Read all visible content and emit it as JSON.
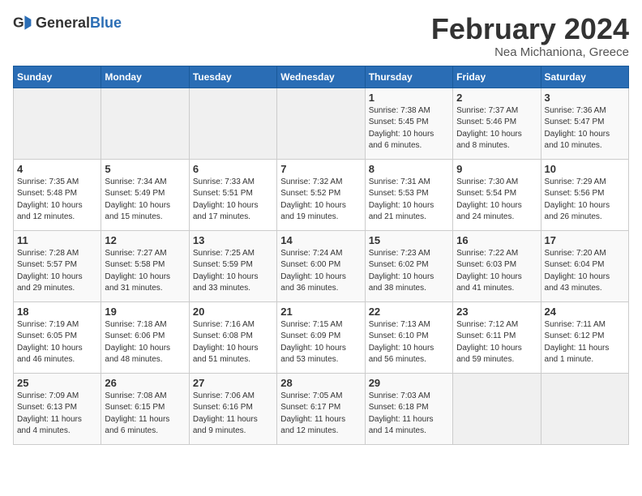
{
  "header": {
    "logo_general": "General",
    "logo_blue": "Blue",
    "month_title": "February 2024",
    "location": "Nea Michaniona, Greece"
  },
  "days_of_week": [
    "Sunday",
    "Monday",
    "Tuesday",
    "Wednesday",
    "Thursday",
    "Friday",
    "Saturday"
  ],
  "weeks": [
    {
      "days": [
        {
          "num": "",
          "info": ""
        },
        {
          "num": "",
          "info": ""
        },
        {
          "num": "",
          "info": ""
        },
        {
          "num": "",
          "info": ""
        },
        {
          "num": "1",
          "info": "Sunrise: 7:38 AM\nSunset: 5:45 PM\nDaylight: 10 hours\nand 6 minutes."
        },
        {
          "num": "2",
          "info": "Sunrise: 7:37 AM\nSunset: 5:46 PM\nDaylight: 10 hours\nand 8 minutes."
        },
        {
          "num": "3",
          "info": "Sunrise: 7:36 AM\nSunset: 5:47 PM\nDaylight: 10 hours\nand 10 minutes."
        }
      ]
    },
    {
      "days": [
        {
          "num": "4",
          "info": "Sunrise: 7:35 AM\nSunset: 5:48 PM\nDaylight: 10 hours\nand 12 minutes."
        },
        {
          "num": "5",
          "info": "Sunrise: 7:34 AM\nSunset: 5:49 PM\nDaylight: 10 hours\nand 15 minutes."
        },
        {
          "num": "6",
          "info": "Sunrise: 7:33 AM\nSunset: 5:51 PM\nDaylight: 10 hours\nand 17 minutes."
        },
        {
          "num": "7",
          "info": "Sunrise: 7:32 AM\nSunset: 5:52 PM\nDaylight: 10 hours\nand 19 minutes."
        },
        {
          "num": "8",
          "info": "Sunrise: 7:31 AM\nSunset: 5:53 PM\nDaylight: 10 hours\nand 21 minutes."
        },
        {
          "num": "9",
          "info": "Sunrise: 7:30 AM\nSunset: 5:54 PM\nDaylight: 10 hours\nand 24 minutes."
        },
        {
          "num": "10",
          "info": "Sunrise: 7:29 AM\nSunset: 5:56 PM\nDaylight: 10 hours\nand 26 minutes."
        }
      ]
    },
    {
      "days": [
        {
          "num": "11",
          "info": "Sunrise: 7:28 AM\nSunset: 5:57 PM\nDaylight: 10 hours\nand 29 minutes."
        },
        {
          "num": "12",
          "info": "Sunrise: 7:27 AM\nSunset: 5:58 PM\nDaylight: 10 hours\nand 31 minutes."
        },
        {
          "num": "13",
          "info": "Sunrise: 7:25 AM\nSunset: 5:59 PM\nDaylight: 10 hours\nand 33 minutes."
        },
        {
          "num": "14",
          "info": "Sunrise: 7:24 AM\nSunset: 6:00 PM\nDaylight: 10 hours\nand 36 minutes."
        },
        {
          "num": "15",
          "info": "Sunrise: 7:23 AM\nSunset: 6:02 PM\nDaylight: 10 hours\nand 38 minutes."
        },
        {
          "num": "16",
          "info": "Sunrise: 7:22 AM\nSunset: 6:03 PM\nDaylight: 10 hours\nand 41 minutes."
        },
        {
          "num": "17",
          "info": "Sunrise: 7:20 AM\nSunset: 6:04 PM\nDaylight: 10 hours\nand 43 minutes."
        }
      ]
    },
    {
      "days": [
        {
          "num": "18",
          "info": "Sunrise: 7:19 AM\nSunset: 6:05 PM\nDaylight: 10 hours\nand 46 minutes."
        },
        {
          "num": "19",
          "info": "Sunrise: 7:18 AM\nSunset: 6:06 PM\nDaylight: 10 hours\nand 48 minutes."
        },
        {
          "num": "20",
          "info": "Sunrise: 7:16 AM\nSunset: 6:08 PM\nDaylight: 10 hours\nand 51 minutes."
        },
        {
          "num": "21",
          "info": "Sunrise: 7:15 AM\nSunset: 6:09 PM\nDaylight: 10 hours\nand 53 minutes."
        },
        {
          "num": "22",
          "info": "Sunrise: 7:13 AM\nSunset: 6:10 PM\nDaylight: 10 hours\nand 56 minutes."
        },
        {
          "num": "23",
          "info": "Sunrise: 7:12 AM\nSunset: 6:11 PM\nDaylight: 10 hours\nand 59 minutes."
        },
        {
          "num": "24",
          "info": "Sunrise: 7:11 AM\nSunset: 6:12 PM\nDaylight: 11 hours\nand 1 minute."
        }
      ]
    },
    {
      "days": [
        {
          "num": "25",
          "info": "Sunrise: 7:09 AM\nSunset: 6:13 PM\nDaylight: 11 hours\nand 4 minutes."
        },
        {
          "num": "26",
          "info": "Sunrise: 7:08 AM\nSunset: 6:15 PM\nDaylight: 11 hours\nand 6 minutes."
        },
        {
          "num": "27",
          "info": "Sunrise: 7:06 AM\nSunset: 6:16 PM\nDaylight: 11 hours\nand 9 minutes."
        },
        {
          "num": "28",
          "info": "Sunrise: 7:05 AM\nSunset: 6:17 PM\nDaylight: 11 hours\nand 12 minutes."
        },
        {
          "num": "29",
          "info": "Sunrise: 7:03 AM\nSunset: 6:18 PM\nDaylight: 11 hours\nand 14 minutes."
        },
        {
          "num": "",
          "info": ""
        },
        {
          "num": "",
          "info": ""
        }
      ]
    }
  ]
}
